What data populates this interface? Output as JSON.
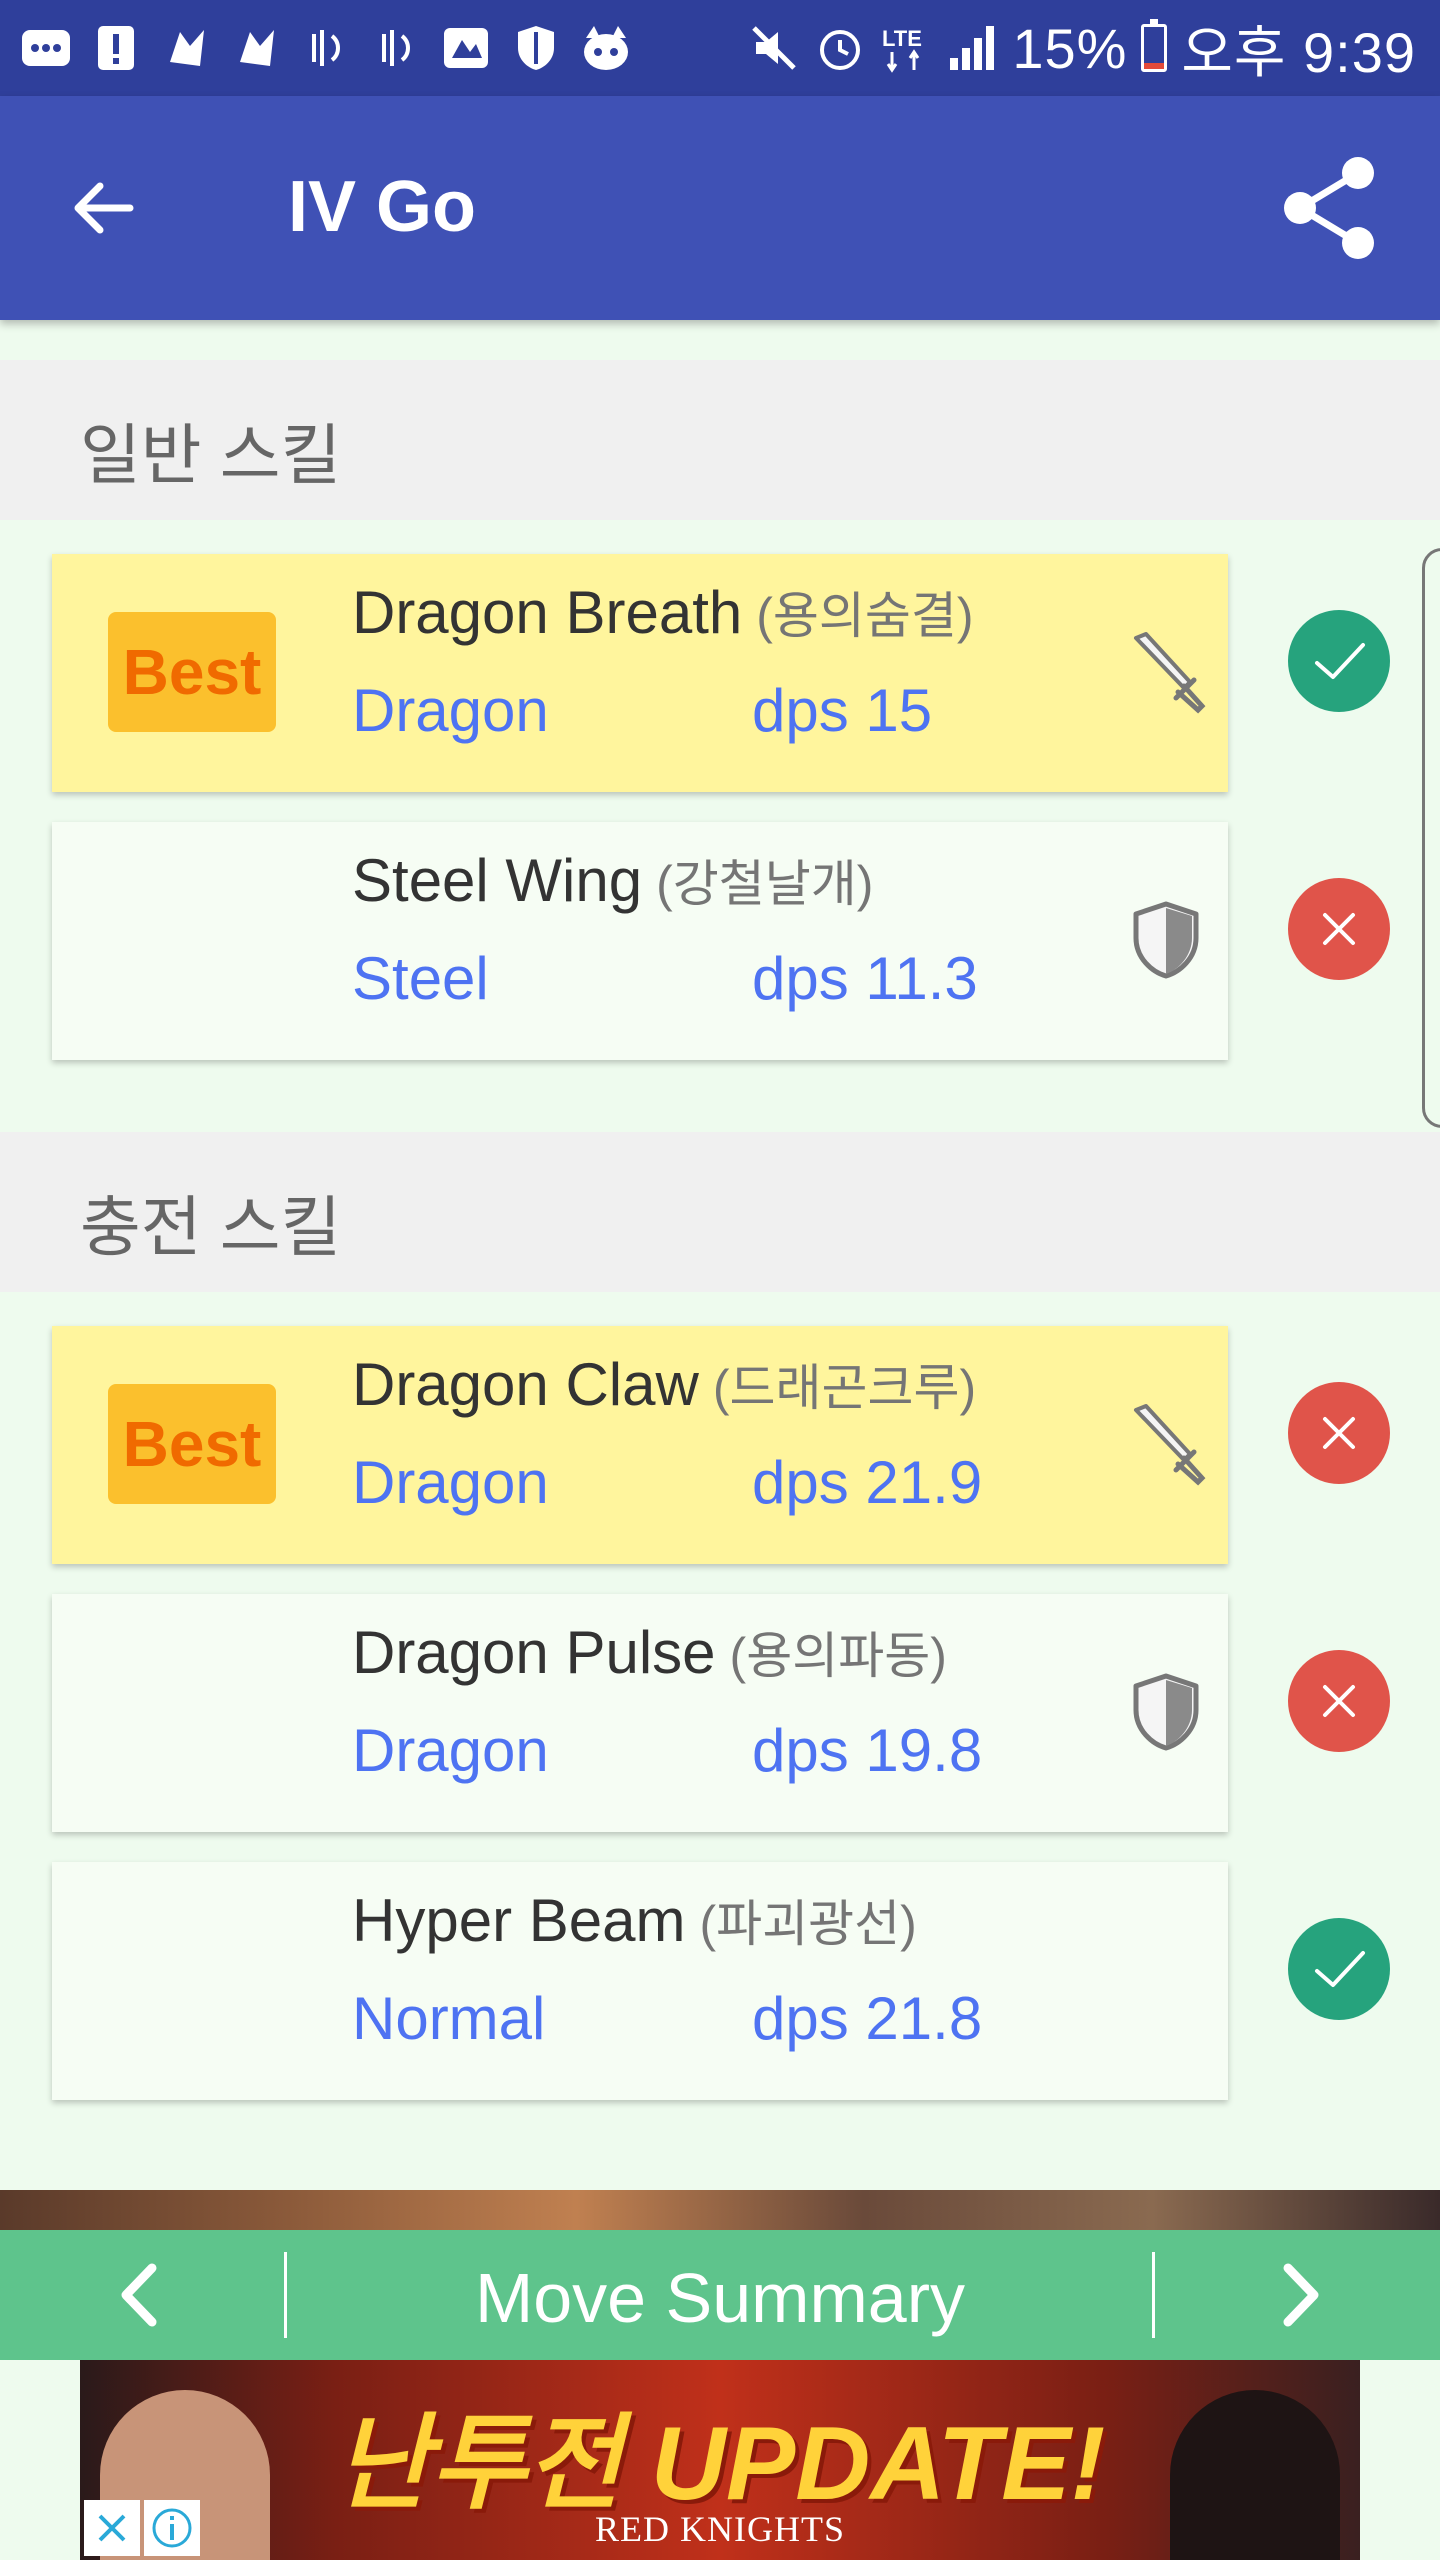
{
  "status_bar": {
    "battery_percent": "15%",
    "time": "오후 9:39",
    "network": "LTE",
    "battery_level": 0.15,
    "left_icons": [
      "chat-icon",
      "alert-icon",
      "pokemon-icon",
      "pokemon-icon",
      "vibrate-icon",
      "vibrate-icon",
      "image-icon",
      "shield-icon",
      "raccoon-icon"
    ],
    "right_icons": [
      "mute-icon",
      "alarm-icon",
      "lte-icon",
      "signal-icon",
      "battery-icon"
    ]
  },
  "app_bar": {
    "title": "IV Go",
    "back_icon": "arrow-back-icon",
    "share_icon": "share-icon",
    "color": "#3f51b5"
  },
  "sections": [
    {
      "title": "일반 스킬",
      "moves": [
        {
          "best": true,
          "best_label": "Best",
          "name": "Dragon Breath",
          "name_kr": "(용의숨결)",
          "type": "Dragon",
          "dps": "dps 15",
          "role_icon": "sword-icon",
          "status": "ok"
        },
        {
          "best": false,
          "name": "Steel Wing",
          "name_kr": "(강철날개)",
          "type": "Steel",
          "dps": "dps 11.3",
          "role_icon": "shield-icon",
          "status": "bad"
        }
      ]
    },
    {
      "title": "충전 스킬",
      "moves": [
        {
          "best": true,
          "best_label": "Best",
          "name": "Dragon Claw",
          "name_kr": "(드래곤크루)",
          "type": "Dragon",
          "dps": "dps 21.9",
          "role_icon": "sword-icon",
          "status": "bad"
        },
        {
          "best": false,
          "name": "Dragon Pulse",
          "name_kr": "(용의파동)",
          "type": "Dragon",
          "dps": "dps 19.8",
          "role_icon": "shield-icon",
          "status": "bad"
        },
        {
          "best": false,
          "name": "Hyper Beam",
          "name_kr": "(파괴광선)",
          "type": "Normal",
          "dps": "dps 21.8",
          "role_icon": "none",
          "status": "ok"
        }
      ]
    }
  ],
  "bottom_nav": {
    "title": "Move Summary",
    "prev_icon": "chevron-left-icon",
    "next_icon": "chevron-right-icon",
    "color": "#5ec48c"
  },
  "ad": {
    "headline": "난투전 UPDATE!",
    "sub": "RED KNIGHTS",
    "close_icon": "close-icon",
    "info_icon": "info-icon"
  },
  "colors": {
    "best_card": "#fff59d",
    "best_badge": "#fbc02d",
    "ok": "#26a37d",
    "bad": "#e0544a",
    "type_text": "#4e73f2"
  }
}
